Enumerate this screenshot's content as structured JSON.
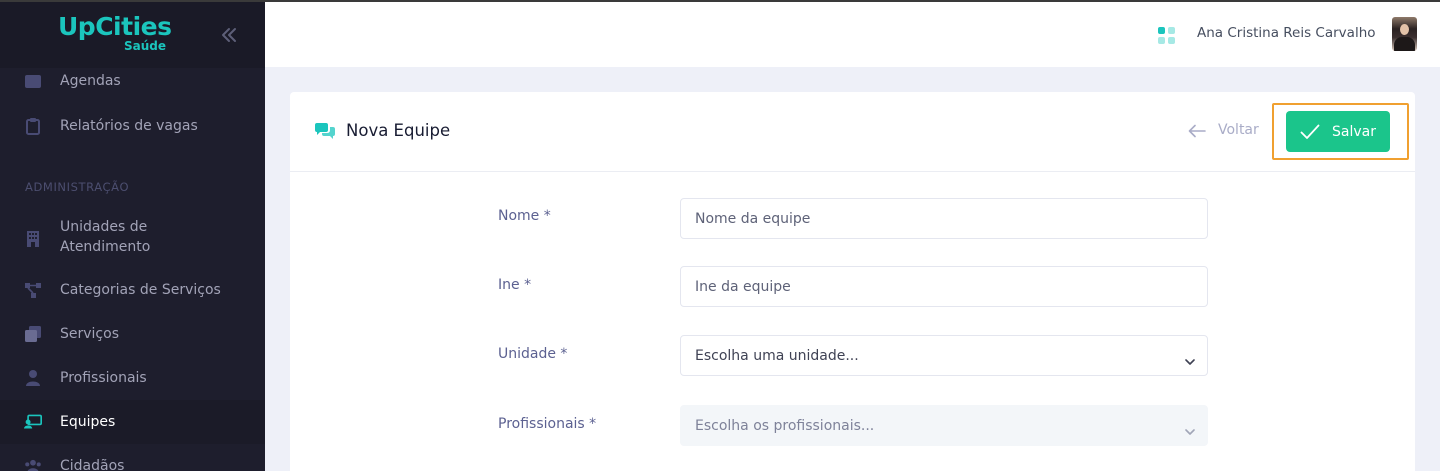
{
  "brand": {
    "name": "UpCities",
    "sub": "Saúde"
  },
  "sidebar": {
    "section_admin": "ADMINISTRAÇÃO",
    "items": [
      {
        "label": "Agendas",
        "icon": "calendar-icon"
      },
      {
        "label": "Relatórios de vagas",
        "icon": "clipboard-icon"
      },
      {
        "label": "Unidades de Atendimento",
        "label_line1": "Unidades de",
        "label_line2": "Atendimento",
        "icon": "building-icon"
      },
      {
        "label": "Categorias de Serviços",
        "icon": "hierarchy-icon"
      },
      {
        "label": "Serviços",
        "icon": "layers-icon"
      },
      {
        "label": "Profissionais",
        "icon": "user-icon"
      },
      {
        "label": "Equipes",
        "icon": "team-icon",
        "active": true
      },
      {
        "label": "Cidadãos",
        "icon": "users-icon"
      }
    ]
  },
  "header": {
    "user_name": "Ana Cristina Reis Carvalho",
    "apps_icon": "apps-grid-icon"
  },
  "card": {
    "title": "Nova Equipe",
    "title_icon": "chat-bubbles-icon",
    "back_label": "Voltar",
    "save_label": "Salvar"
  },
  "form": {
    "nome": {
      "label": "Nome *",
      "placeholder": "Nome da equipe",
      "value": ""
    },
    "ine": {
      "label": "Ine *",
      "placeholder": "Ine da equipe",
      "value": ""
    },
    "unidade": {
      "label": "Unidade *",
      "selected": "Escolha uma unidade..."
    },
    "profissionais": {
      "label": "Profissionais *",
      "selected": "Escolha os profissionais..."
    }
  },
  "colors": {
    "sidebar_bg": "#1e1e2d",
    "accent": "#1bc5bd",
    "save_button": "#1bc58b",
    "highlight": "#f0a030"
  }
}
